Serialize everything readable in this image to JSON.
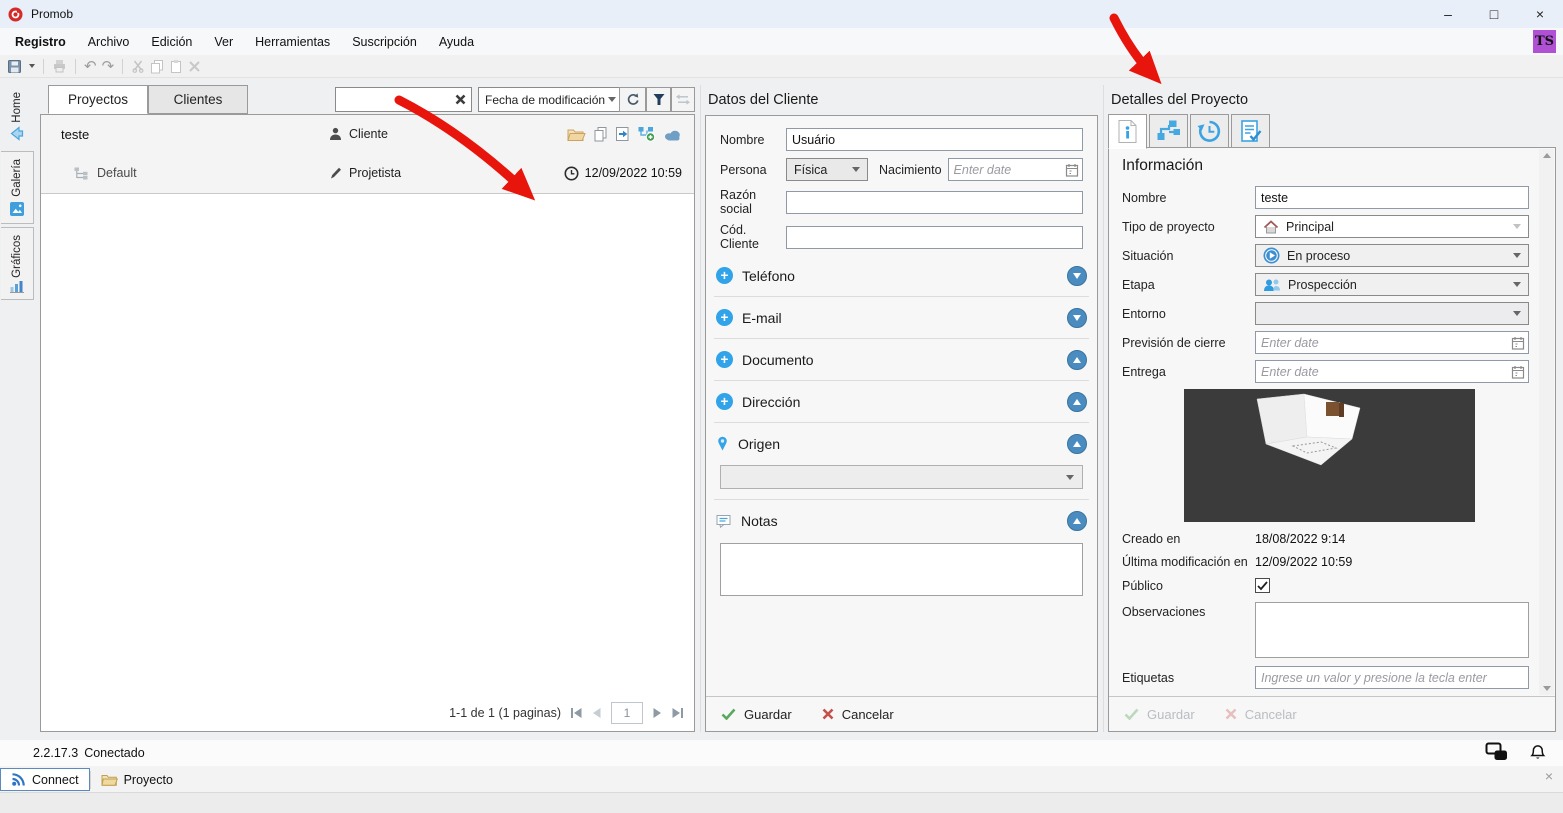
{
  "window": {
    "title": "Promob",
    "min": "–",
    "max": "□",
    "close": "×"
  },
  "menu": {
    "items": [
      "Registro",
      "Archivo",
      "Edición",
      "Ver",
      "Herramientas",
      "Suscripción",
      "Ayuda"
    ],
    "avatar": "TS"
  },
  "glyphs": {
    "plus": "+",
    "undo": "↶",
    "redo": "↷"
  },
  "sidebar": {
    "home": "Home",
    "galeria": "Galería",
    "graficos": "Gráficos"
  },
  "projects": {
    "tab_projects": "Proyectos",
    "tab_clients": "Clientes",
    "search_value": "",
    "sort_value": "Fecha de modificación",
    "row_project_name": "teste",
    "row_client_label": "Cliente",
    "row_env_name": "Default",
    "row_designer_label": "Projetista",
    "row_modified": "12/09/2022 10:59",
    "pagination_summary": "1-1 de 1 (1 paginas)",
    "page_value": "1"
  },
  "client_panel": {
    "title": "Datos del Cliente",
    "nombre_label": "Nombre",
    "nombre_value": "Usuário",
    "persona_label": "Persona",
    "persona_value": "Física",
    "nacimiento_label": "Nacimiento",
    "date_placeholder": "Enter date",
    "razon_label": "Razón social",
    "cod_label": "Cód. Cliente",
    "sec_telefono": "Teléfono",
    "sec_email": "E-mail",
    "sec_documento": "Documento",
    "sec_direccion": "Dirección",
    "sec_origen": "Origen",
    "sec_notas": "Notas",
    "save_label": "Guardar",
    "cancel_label": "Cancelar"
  },
  "details_panel": {
    "title": "Detalles del Proyecto",
    "section_title": "Información",
    "nombre_label": "Nombre",
    "nombre_value": "teste",
    "tipo_label": "Tipo de proyecto",
    "tipo_value": "Principal",
    "situacion_label": "Situación",
    "situacion_value": "En proceso",
    "etapa_label": "Etapa",
    "etapa_value": "Prospección",
    "entorno_label": "Entorno",
    "prevision_label": "Previsión de cierre",
    "entrega_label": "Entrega",
    "date_placeholder": "Enter date",
    "creado_label": "Creado en",
    "creado_value": "18/08/2022 9:14",
    "modificacion_label": "Última modificación en",
    "modificacion_value": "12/09/2022 10:59",
    "publico_label": "Público",
    "observaciones_label": "Observaciones",
    "etiquetas_label": "Etiquetas",
    "etiquetas_placeholder": "Ingrese un valor y presione la tecla enter",
    "save_label": "Guardar",
    "cancel_label": "Cancelar"
  },
  "statusbar": {
    "version": "2.2.17.3",
    "connection": "Conectado"
  },
  "bottom_tabs": {
    "connect": "Connect",
    "proyecto": "Proyecto",
    "close": "×"
  }
}
